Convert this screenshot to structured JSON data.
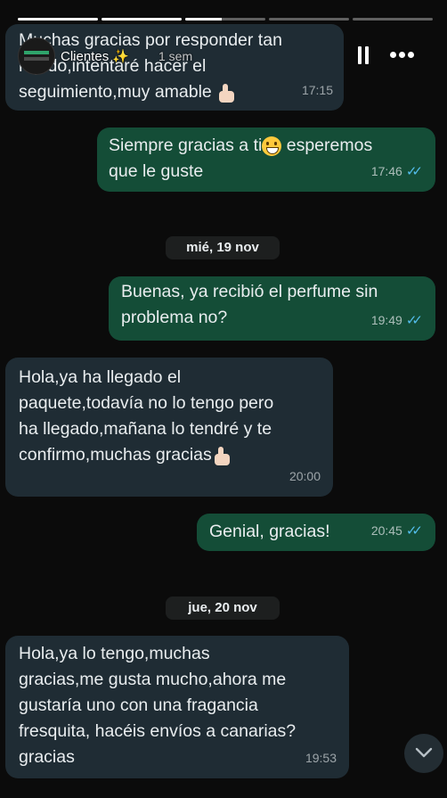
{
  "story": {
    "segments": [
      1,
      1,
      0.45,
      0,
      0
    ],
    "username": "Clientes ✨",
    "time_ago": "1 sem"
  },
  "messages": [
    {
      "dir": "in",
      "text": "Muchas gracias por responder tan\nrápido,intentaré hacer el\nseguimiento,muy amable",
      "emoji": "thumbs-up",
      "time": "17:15"
    },
    {
      "dir": "out",
      "text": "Siempre gracias a ti",
      "emoji_inline": "grinning-face",
      "text_after": " esperemos\nque le guste",
      "time": "17:46",
      "status": "read"
    },
    {
      "dir": "out",
      "text": "Buenas, ya recibió el perfume sin\nproblema no?",
      "time": "19:49",
      "status": "read"
    },
    {
      "dir": "in",
      "text": "Hola,ya ha llegado el\npaquete,todavía no lo tengo pero\nha llegado,mañana lo tendré y te\nconfirmo,muchas gracias",
      "emoji": "thumbs-up",
      "time": "20:00"
    },
    {
      "dir": "out",
      "text": "Genial, gracias!",
      "time": "20:45",
      "status": "read"
    },
    {
      "dir": "in",
      "text": "Hola,ya lo tengo,muchas\ngracias,me gusta mucho,ahora me\ngustaría uno con una fragancia\nfresquita, hacéis envíos a canarias?\ngracias",
      "time": "19:53"
    }
  ],
  "date_separators": [
    "mié, 19 nov",
    "jue, 20 nov"
  ],
  "icons": {
    "pause": "pause-icon",
    "more": "more-options-icon",
    "scroll": "chevron-down-icon"
  },
  "colors": {
    "incoming": "#1f2c34",
    "outgoing": "#144d37",
    "read_ticks": "#53bdeb",
    "background": "#0b0b0b"
  }
}
